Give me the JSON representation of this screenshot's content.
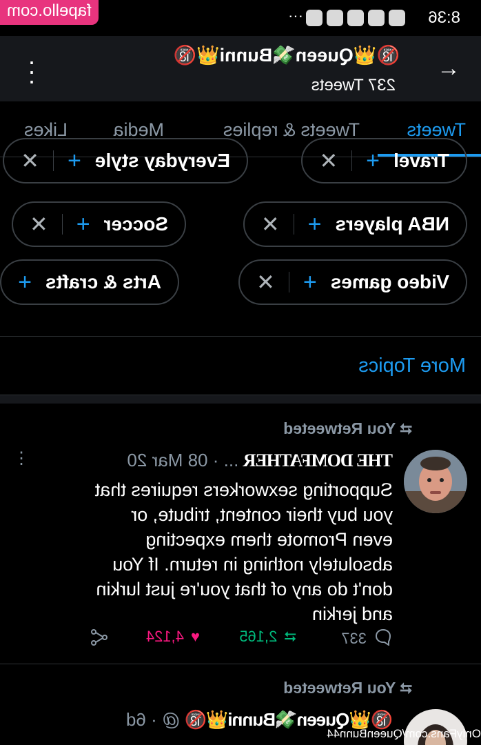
{
  "watermark": "fapello.com",
  "status_bar": {
    "time": "8:36"
  },
  "header": {
    "title": "🔞👑Queen💸Bunni👑🔞",
    "tweet_count": "237 Tweets"
  },
  "tabs": [
    "Tweets",
    "Tweets & replies",
    "Media",
    "Likes"
  ],
  "topic_chips": [
    [
      "Travel",
      "Everyday style"
    ],
    [
      "NBA players",
      "Soccer"
    ],
    [
      "Video games",
      "Arts & crafts"
    ]
  ],
  "more_topics": "More Topics",
  "tweets": [
    {
      "retweeted_label": "You Retweeted",
      "author": "THE DOMFATHER",
      "ellipsis": "...",
      "date": "08 Mar 20",
      "text": "Supporting sexworkers requires that you buy their content, tribute, or even Promote them expecting absolutely nothing in return. If You don't do any of that you're just lurkin and jerkin",
      "replies": "337",
      "retweets": "2,165",
      "likes": "4,124"
    },
    {
      "retweeted_label": "You Retweeted",
      "author": "🔞👑Queen💸Bunni👑🔞",
      "handle": "@",
      "date": "6d"
    }
  ],
  "bottom_watermark": "OnlyFans.com/QueenBunn44",
  "colors": {
    "accent": "#1d9bf0",
    "like": "#f91880",
    "retweet": "#00ba7c",
    "watermark": "#e8347e"
  }
}
